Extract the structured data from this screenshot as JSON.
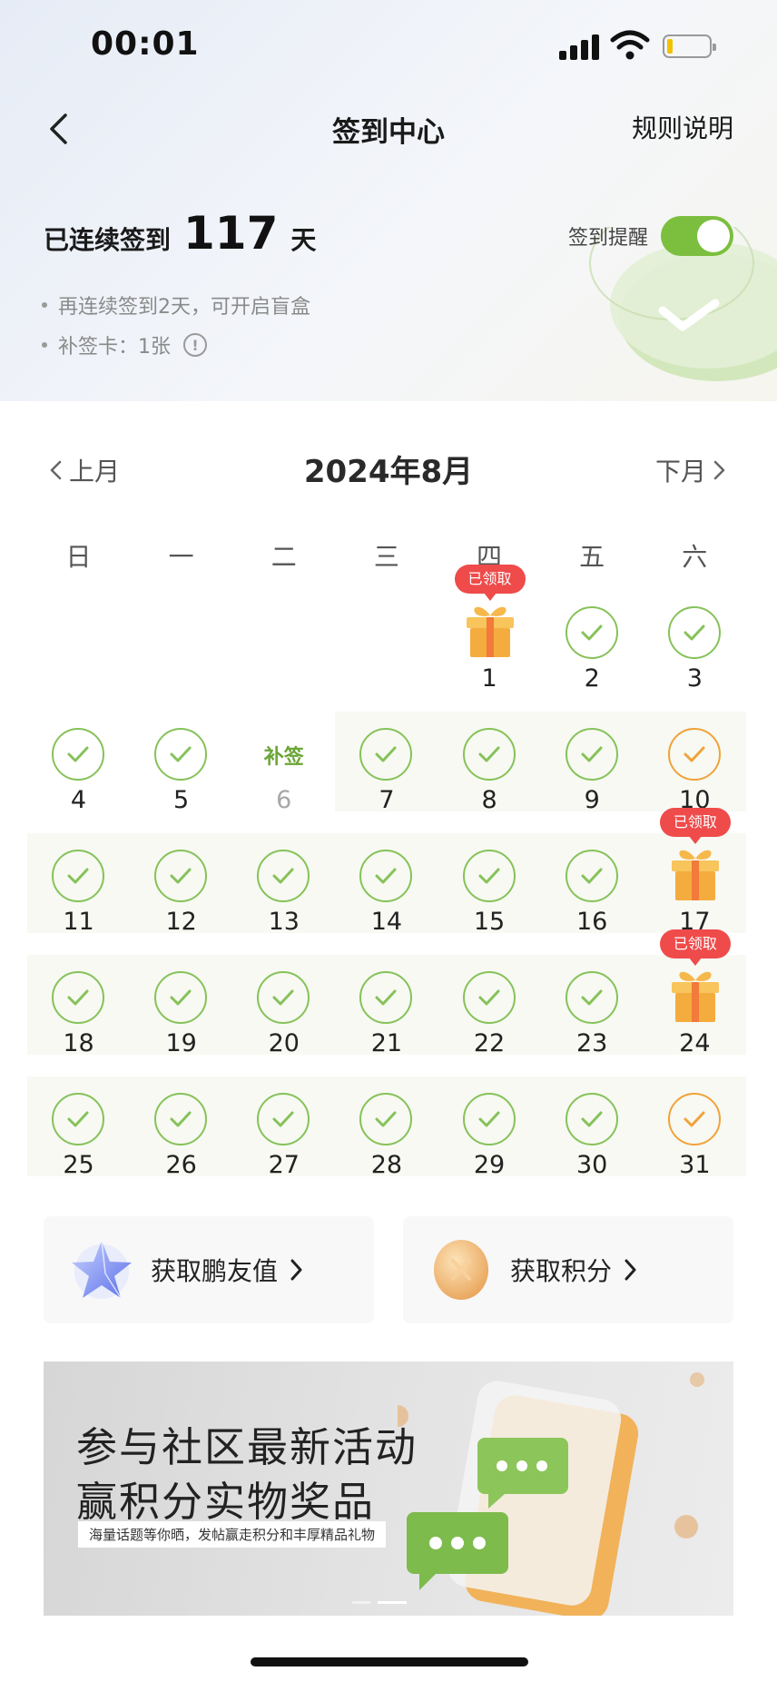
{
  "status_bar": {
    "time": "00:01"
  },
  "nav": {
    "title": "签到中心",
    "rules": "规则说明"
  },
  "streak": {
    "label": "已连续签到",
    "count": "117",
    "unit": "天"
  },
  "tips": {
    "blind_box": "再连续签到2天，可开启盲盒",
    "makeup_card": "补签卡：1张"
  },
  "reminder": {
    "label": "签到提醒",
    "enabled": true
  },
  "calendar": {
    "prev_label": "上月",
    "next_label": "下月",
    "month_title": "2024年8月",
    "weekdays": [
      "日",
      "一",
      "二",
      "三",
      "四",
      "五",
      "六"
    ],
    "first_weekday_index": 4,
    "makeup_label": "补签",
    "claimed_label": "已领取",
    "days": [
      {
        "d": "1",
        "state": "gift"
      },
      {
        "d": "2",
        "state": "check"
      },
      {
        "d": "3",
        "state": "check"
      },
      {
        "d": "4",
        "state": "check"
      },
      {
        "d": "5",
        "state": "check"
      },
      {
        "d": "6",
        "state": "makeup"
      },
      {
        "d": "7",
        "state": "check"
      },
      {
        "d": "8",
        "state": "check"
      },
      {
        "d": "9",
        "state": "check"
      },
      {
        "d": "10",
        "state": "today"
      },
      {
        "d": "11",
        "state": "check"
      },
      {
        "d": "12",
        "state": "check"
      },
      {
        "d": "13",
        "state": "check"
      },
      {
        "d": "14",
        "state": "check"
      },
      {
        "d": "15",
        "state": "check"
      },
      {
        "d": "16",
        "state": "check"
      },
      {
        "d": "17",
        "state": "gift"
      },
      {
        "d": "18",
        "state": "check"
      },
      {
        "d": "19",
        "state": "check"
      },
      {
        "d": "20",
        "state": "check"
      },
      {
        "d": "21",
        "state": "check"
      },
      {
        "d": "22",
        "state": "check"
      },
      {
        "d": "23",
        "state": "check"
      },
      {
        "d": "24",
        "state": "gift"
      },
      {
        "d": "25",
        "state": "check"
      },
      {
        "d": "26",
        "state": "check"
      },
      {
        "d": "27",
        "state": "check"
      },
      {
        "d": "28",
        "state": "check"
      },
      {
        "d": "29",
        "state": "check"
      },
      {
        "d": "30",
        "state": "check"
      },
      {
        "d": "31",
        "state": "today"
      }
    ]
  },
  "actions": {
    "friend_value": "获取鹏友值",
    "points": "获取积分"
  },
  "banner": {
    "line1": "参与社区最新活动",
    "line2": "赢积分实物奖品",
    "sub": "海量话题等你晒，发帖赢走积分和丰厚精品礼物"
  },
  "colors": {
    "accent_green": "#86c25a",
    "today_orange": "#f0a33b",
    "badge_red": "#ef4b4b",
    "toggle_green": "#7cbf3f"
  }
}
